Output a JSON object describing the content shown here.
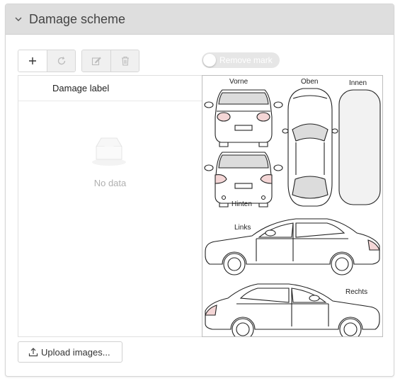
{
  "panel": {
    "title": "Damage scheme",
    "collapse_icon": "chevron-down-icon"
  },
  "toolbar": {
    "add_icon": "plus-icon",
    "refresh_icon": "refresh-icon",
    "edit_icon": "edit-icon",
    "delete_icon": "trash-icon",
    "remove_mark_label": "Remove mark",
    "remove_mark_on": false
  },
  "table": {
    "columns": [
      "Damage label"
    ],
    "rows": [],
    "empty_text": "No data",
    "empty_icon": "empty-inbox-icon"
  },
  "scheme": {
    "labels": {
      "front": "Vorne",
      "top": "Oben",
      "inside": "Innen",
      "rear": "Hinten",
      "left": "Links",
      "right": "Rechts"
    }
  },
  "upload": {
    "label": "Upload images...",
    "icon": "upload-icon"
  },
  "colors": {
    "header_bg": "#dedede",
    "border": "#d6d6d6",
    "muted_text": "#b0b0b0",
    "glass": "#dcdcdc",
    "light_tint": "#f4d6d6"
  }
}
